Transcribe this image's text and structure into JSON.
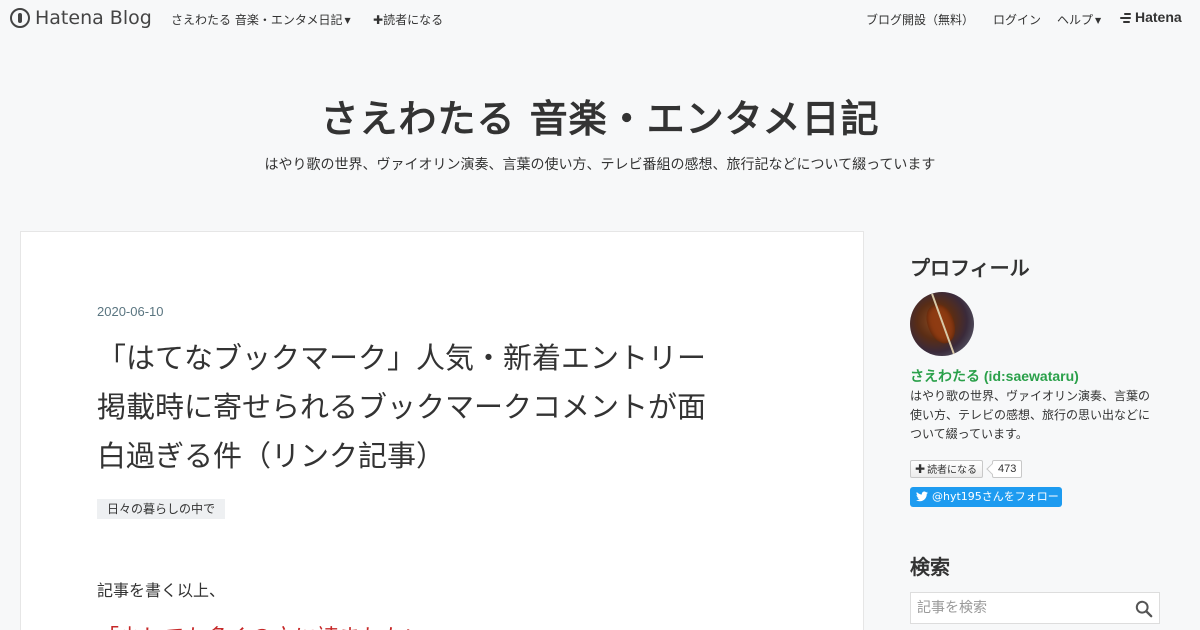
{
  "navbar": {
    "brand": "Hatena Blog",
    "blog_menu": "さえわたる 音楽・エンタメ日記",
    "subscribe": "読者になる",
    "open_blog": "ブログ開設（無料）",
    "login": "ログイン",
    "help": "ヘルプ",
    "hatena": "Hatena"
  },
  "header": {
    "title": "さえわたる 音楽・エンタメ日記",
    "description": "はやり歌の世界、ヴァイオリン演奏、言葉の使い方、テレビ番組の感想、旅行記などについて綴っています"
  },
  "article": {
    "date": "2020-06-10",
    "title_lines": [
      "「はてなブックマーク」人気・新着エントリー",
      "掲載時に寄せられるブックマークコメントが面",
      "白過ぎる件（リンク記事）"
    ],
    "category": "日々の暮らしの中で",
    "body_first": "記事を書く以上、",
    "body_red": "「少しでも多くの方に読まれたい」"
  },
  "sidebar": {
    "profile_heading": "プロフィール",
    "profile_name": "さえわたる (id:saewataru)",
    "profile_desc": "はやり歌の世界、ヴァイオリン演奏、言葉の使い方、テレビの感想、旅行の思い出などについて綴っています。",
    "reader_button": "読者になる",
    "reader_count": "473",
    "twitter_follow": "@hyt195さんをフォロー",
    "search_heading": "検索",
    "search_placeholder": "記事を検索"
  },
  "colors": {
    "background": "#f7f8f9",
    "profile_name": "#2aa04a",
    "twitter": "#1d9bf0",
    "highlight_text": "#c62828",
    "date": "#5a7580"
  }
}
